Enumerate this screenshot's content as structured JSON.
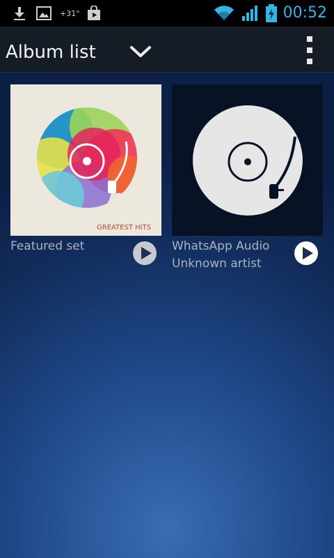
{
  "status_bar": {
    "temperature": "+31°",
    "time": "00:52",
    "icons": [
      "download-icon",
      "image-icon",
      "store-bag-icon",
      "wifi-icon",
      "signal-icon",
      "battery-charging-icon"
    ]
  },
  "action_bar": {
    "title": "Album list",
    "dropdown_icon": "chevron-down-icon",
    "overflow_icon": "overflow-menu-icon"
  },
  "albums": [
    {
      "title": "Featured set",
      "subtitle": "",
      "cover_text": "GREATEST HITS",
      "play_icon": "play-icon"
    },
    {
      "title": "WhatsApp Audio",
      "subtitle": "Unknown artist",
      "cover_text": "",
      "play_icon": "play-icon"
    }
  ],
  "colors": {
    "accent": "#33b5e5",
    "background": "#1f4a8b",
    "actionbar": "#151c26"
  }
}
